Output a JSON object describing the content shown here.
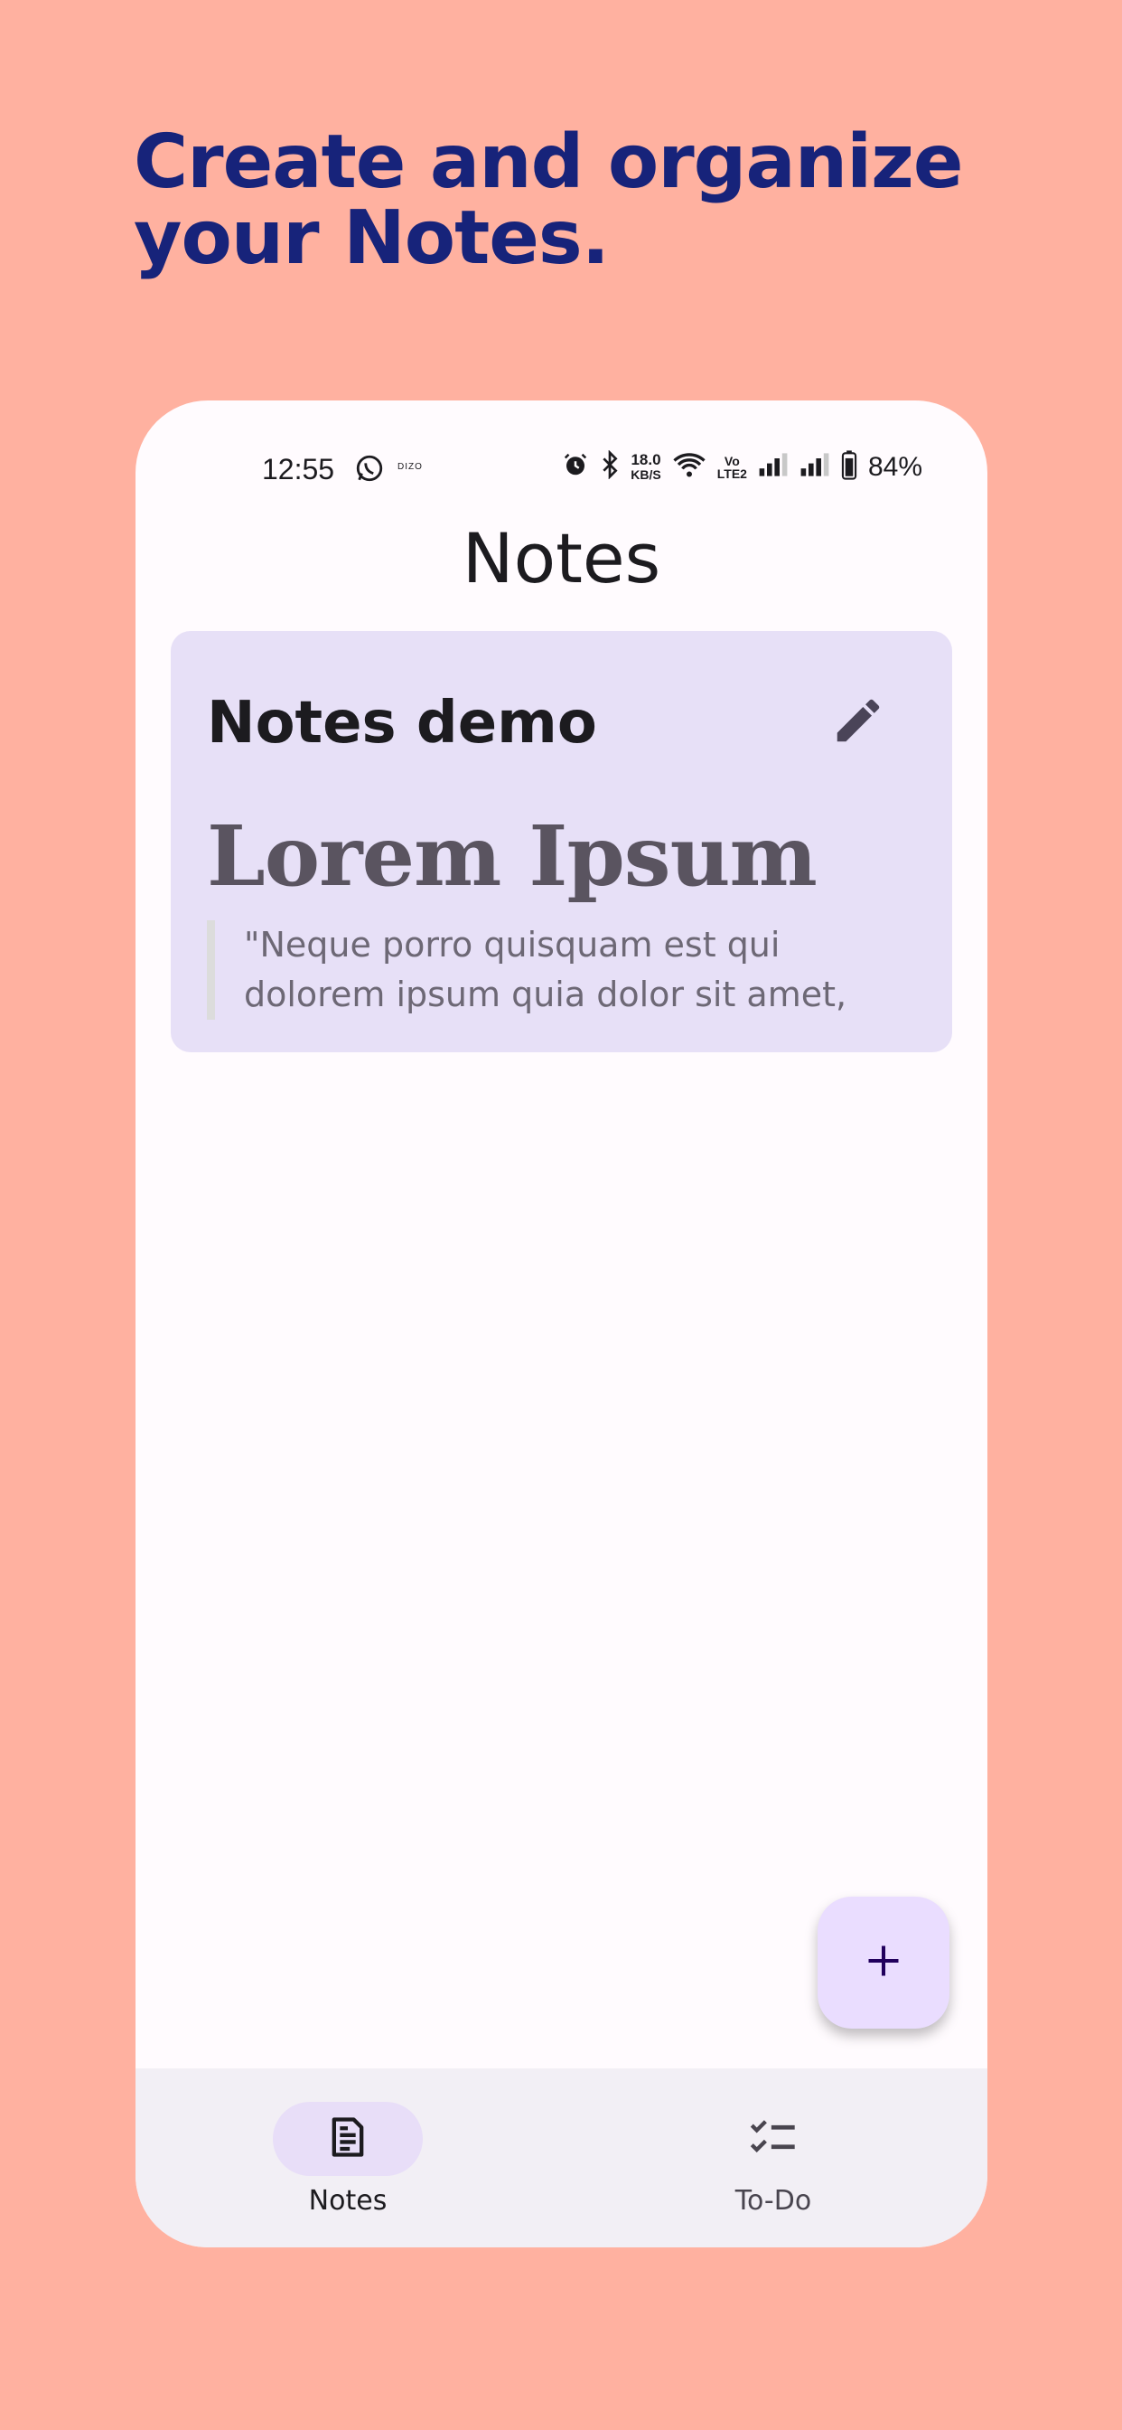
{
  "headline": {
    "line1": "Create and organize",
    "line2": "your Notes."
  },
  "status_bar": {
    "time": "12:55",
    "brand_glyph": "DIZO",
    "network_speed": "18.0",
    "network_unit": "KB/S",
    "volte_top": "Vo",
    "volte_bottom": "LTE2",
    "battery": "84%"
  },
  "app": {
    "title": "Notes"
  },
  "notes": [
    {
      "title": "Notes demo",
      "heading": "Lorem Ipsum",
      "quote_line1": "\"Neque porro quisquam est qui",
      "quote_line2": "dolorem ipsum quia dolor sit amet,"
    }
  ],
  "bottom_nav": {
    "items": [
      {
        "label": "Notes",
        "icon": "note-icon",
        "active": true
      },
      {
        "label": "To-Do",
        "icon": "checklist-icon",
        "active": false
      }
    ]
  },
  "colors": {
    "background": "#FFB1A0",
    "headline": "#17237A",
    "card": "#E7E0F7",
    "fab": "#EADDFF",
    "nav": "#F2EFF5",
    "nav_active_pill": "#E8DEF8"
  }
}
